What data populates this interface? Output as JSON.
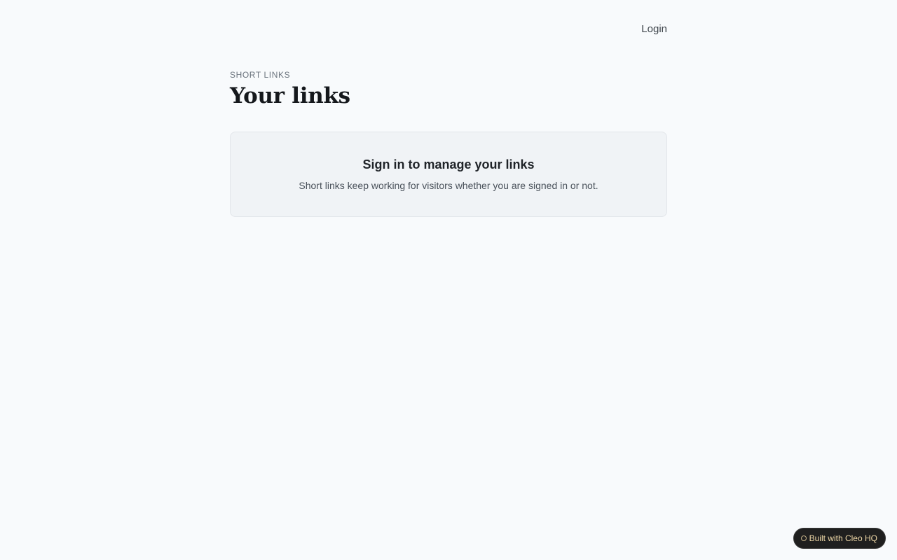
{
  "nav": {
    "login_label": "Login"
  },
  "header": {
    "eyebrow": "SHORT LINKS",
    "title": "Your links"
  },
  "signin_card": {
    "heading": "Sign in to manage your links",
    "text": "Short links keep working for visitors whether you are signed in or not."
  },
  "badge": {
    "icon": "circle-icon",
    "label": "Built with Cleo HQ"
  },
  "colors": {
    "background": "#f8fafc",
    "card_background": "#f0f3f6",
    "badge_background": "#1f1f1f",
    "badge_text": "#f0d9a8"
  }
}
